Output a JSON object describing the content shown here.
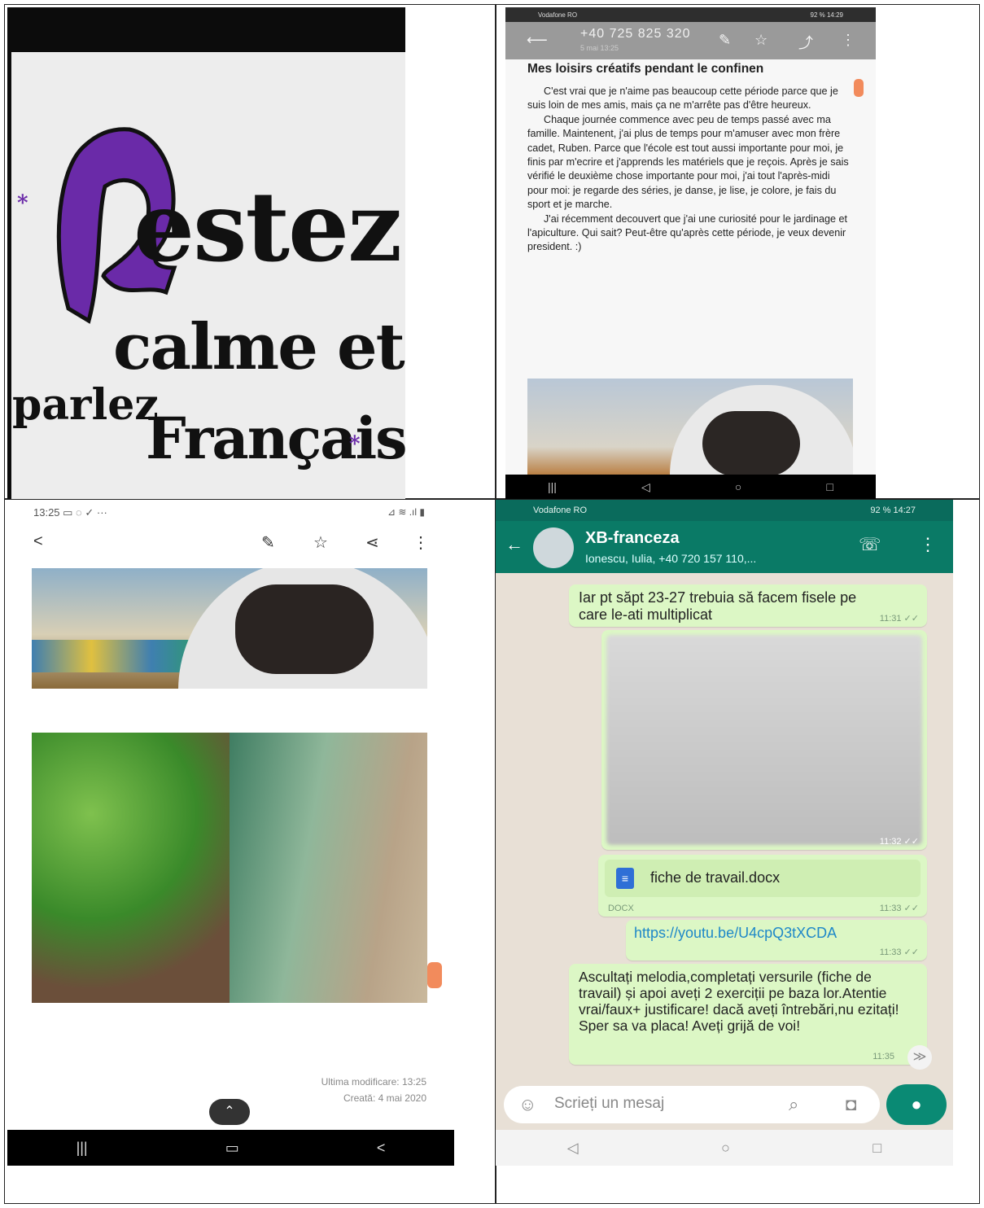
{
  "poster": {
    "line1": "Restez",
    "line2": "calme et",
    "line3a": "parlez",
    "line3b": "Français",
    "star": "*"
  },
  "note_phone": {
    "status_left": "Vodafone RO",
    "status_right": "92 % 14:29",
    "phone_number": "+40 725 825 320",
    "time_sub": "5 mai 13:25",
    "title": "Mes loisirs créatifs pendant le confinen",
    "paragraphs": [
      "C'est vrai que je n'aime pas beaucoup cette période parce que je suis loin de mes amis, mais ça ne m'arrête pas d'être heureux.",
      "Chaque journée commence avec peu de temps passé avec ma famille. Maintenent, j'ai plus de temps pour m'amuser avec mon frère cadet, Ruben. Parce que l'école est tout aussi importante pour moi, je finis par m'ecrire et j'apprends les matériels que je reçois. Après je sais vérifié le deuxième chose importante pour moi, j'ai tout l'après-midi pour moi: je regarde des séries, je danse, je lise, je colore, je fais du sport et je marche.",
      "J'ai récemment decouvert que j'ai une curiosité pour le jardinage et l'apiculture. Qui sait? Peut-être qu'après cette période, je veux devenir president. :)"
    ]
  },
  "gallery_phone": {
    "status_time": "13:25",
    "footer_modified": "Ultima modificare: 13:25",
    "footer_created": "Creată: 4 mai 2020"
  },
  "chat_phone": {
    "status_left": "Vodafone RO",
    "status_right": "92 % 14:27",
    "group_name": "XB-franceza",
    "members": "Ionescu, Iulia, +40 720 157 110,...",
    "messages": [
      {
        "text": "Iar pt săpt 23-27 trebuia să facem fisele pe care le-ati multiplicat",
        "time": "11:31"
      },
      {
        "text": "",
        "time": "11:32"
      },
      {
        "file_name": "fiche de travail.docx",
        "file_type": "DOCX",
        "time": "11:33"
      },
      {
        "text": "https://youtu.be/U4cpQ3tXCDA",
        "time": "11:33"
      },
      {
        "text": "Ascultați melodia,completați versurile (fiche de travail) și apoi aveți 2 exerciții pe baza lor.Atentie vrai/faux+ justificare! dacă aveți întrebări,nu ezitați! Sper sa va placa! Aveți grijă de voi!",
        "time": "11:35"
      }
    ],
    "input_placeholder": "Scrieți un mesaj"
  }
}
